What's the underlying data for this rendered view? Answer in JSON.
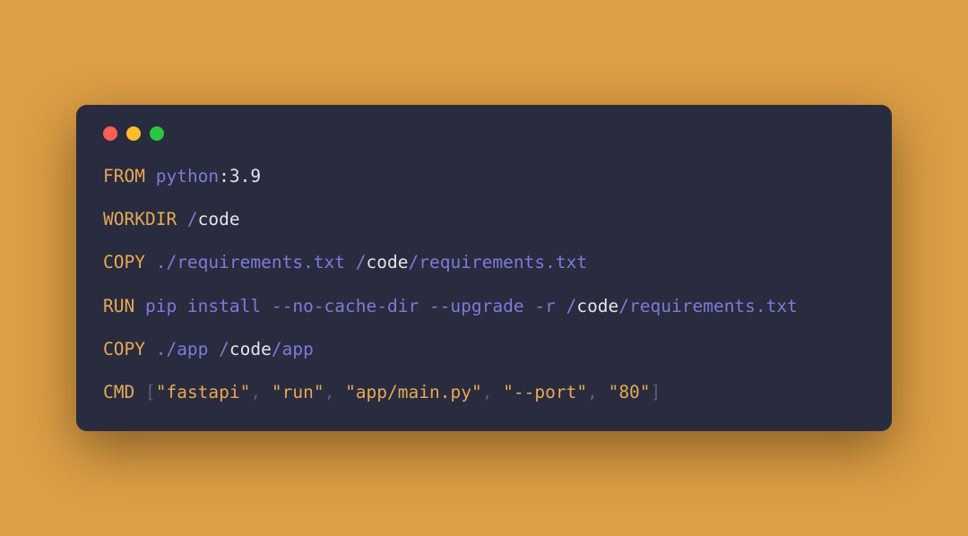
{
  "dockerfile": {
    "lines": [
      {
        "tokens": [
          {
            "text": "FROM",
            "class": "tok-keyword"
          },
          {
            "text": " ",
            "class": "tok-white"
          },
          {
            "text": "python",
            "class": "tok-purple"
          },
          {
            "text": ":",
            "class": "tok-white"
          },
          {
            "text": "3.9",
            "class": "tok-white"
          }
        ]
      },
      {
        "tokens": [
          {
            "text": "WORKDIR",
            "class": "tok-keyword"
          },
          {
            "text": " /",
            "class": "tok-purple"
          },
          {
            "text": "code",
            "class": "tok-white"
          }
        ]
      },
      {
        "tokens": [
          {
            "text": "COPY",
            "class": "tok-keyword"
          },
          {
            "text": " ./requirements.txt /",
            "class": "tok-purple"
          },
          {
            "text": "code",
            "class": "tok-white"
          },
          {
            "text": "/requirements.txt",
            "class": "tok-purple"
          }
        ]
      },
      {
        "tokens": [
          {
            "text": "RUN",
            "class": "tok-keyword"
          },
          {
            "text": " pip install --no-cache-dir --upgrade -r /",
            "class": "tok-purple"
          },
          {
            "text": "code",
            "class": "tok-white"
          },
          {
            "text": "/requirements.txt",
            "class": "tok-purple"
          }
        ]
      },
      {
        "tokens": [
          {
            "text": "COPY",
            "class": "tok-keyword"
          },
          {
            "text": " ./app /",
            "class": "tok-purple"
          },
          {
            "text": "code",
            "class": "tok-white"
          },
          {
            "text": "/app",
            "class": "tok-purple"
          }
        ]
      },
      {
        "tokens": [
          {
            "text": "CMD",
            "class": "tok-keyword"
          },
          {
            "text": " [",
            "class": "tok-muted"
          },
          {
            "text": "\"fastapi\"",
            "class": "tok-string"
          },
          {
            "text": ", ",
            "class": "tok-muted"
          },
          {
            "text": "\"run\"",
            "class": "tok-string"
          },
          {
            "text": ", ",
            "class": "tok-muted"
          },
          {
            "text": "\"app/main.py\"",
            "class": "tok-string"
          },
          {
            "text": ", ",
            "class": "tok-muted"
          },
          {
            "text": "\"--port\"",
            "class": "tok-string"
          },
          {
            "text": ", ",
            "class": "tok-muted"
          },
          {
            "text": "\"80\"",
            "class": "tok-string"
          },
          {
            "text": "]",
            "class": "tok-muted"
          }
        ]
      }
    ]
  }
}
